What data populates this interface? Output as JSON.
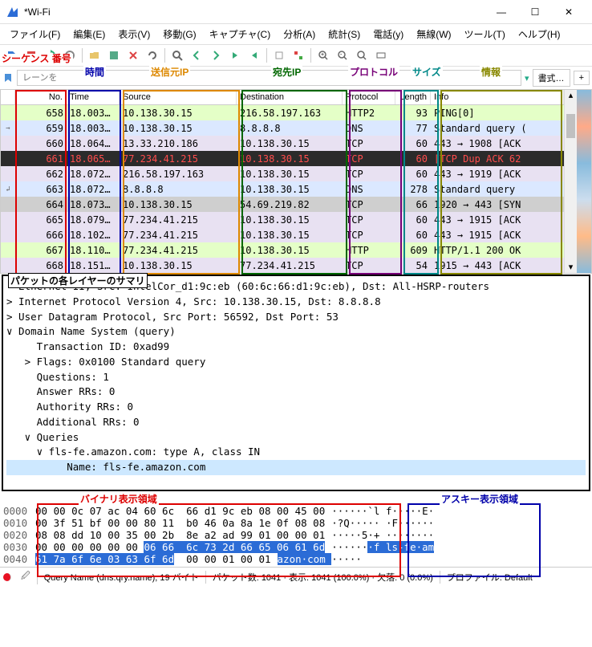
{
  "window": {
    "title": "*Wi-Fi"
  },
  "menu": {
    "file": "ファイル(F)",
    "edit": "編集(E)",
    "view": "表示(V)",
    "go": "移動(G)",
    "capture": "キャプチャ(C)",
    "analyze": "分析(A)",
    "stats": "統計(S)",
    "telephony": "電話(y)",
    "wireless": "無線(W)",
    "tools": "ツール(T)",
    "help": "ヘルプ(H)"
  },
  "filter": {
    "placeholder": "レーンを",
    "expr_btn": "書式…",
    "plus": "+"
  },
  "annotations": {
    "seq": "シーケンス\n番号",
    "time": "時間",
    "src": "送信元IP",
    "dst": "宛先IP",
    "proto": "プロトコル",
    "size": "サイズ",
    "info": "情報",
    "layers": "パケットの各レイヤーのサマリ",
    "binary": "バイナリ表示領域",
    "ascii": "アスキー表示領域"
  },
  "cols": {
    "no": "No.",
    "time": "Time",
    "src": "Source",
    "dst": "Destination",
    "proto": "Protocol",
    "len": "Length",
    "info": "Info"
  },
  "packets": [
    {
      "no": 658,
      "time": "18.003…",
      "src": "10.138.30.15",
      "dst": "216.58.197.163",
      "proto": "HTTP2",
      "len": 93,
      "info": "PING[0]",
      "bg": "#e4ffc7"
    },
    {
      "no": 659,
      "time": "18.003…",
      "src": "10.138.30.15",
      "dst": "8.8.8.8",
      "proto": "DNS",
      "len": 77,
      "info": "Standard query (",
      "bg": "#dbe8ff",
      "g": "→"
    },
    {
      "no": 660,
      "time": "18.064…",
      "src": "13.33.210.186",
      "dst": "10.138.30.15",
      "proto": "TCP",
      "len": 60,
      "info": "443 → 1908 [ACK",
      "bg": "#e8e1f2"
    },
    {
      "no": 661,
      "time": "18.065…",
      "src": "77.234.41.215",
      "dst": "10.138.30.15",
      "proto": "TCP",
      "len": 60,
      "info": "[TCP Dup ACK 62",
      "bg": "#2b2b2b",
      "fg": "#ff4d4d",
      "sel": true
    },
    {
      "no": 662,
      "time": "18.072…",
      "src": "216.58.197.163",
      "dst": "10.138.30.15",
      "proto": "TCP",
      "len": 60,
      "info": "443 → 1919 [ACK",
      "bg": "#e8e1f2"
    },
    {
      "no": 663,
      "time": "18.072…",
      "src": "8.8.8.8",
      "dst": "10.138.30.15",
      "proto": "DNS",
      "len": 278,
      "info": "Standard query",
      "bg": "#dbe8ff",
      "g": "↲"
    },
    {
      "no": 664,
      "time": "18.073…",
      "src": "10.138.30.15",
      "dst": "54.69.219.82",
      "proto": "TCP",
      "len": 66,
      "info": "1920 → 443 [SYN",
      "bg": "#cfcfcf"
    },
    {
      "no": 665,
      "time": "18.079…",
      "src": "77.234.41.215",
      "dst": "10.138.30.15",
      "proto": "TCP",
      "len": 60,
      "info": "443 → 1915 [ACK",
      "bg": "#e8e1f2"
    },
    {
      "no": 666,
      "time": "18.102…",
      "src": "77.234.41.215",
      "dst": "10.138.30.15",
      "proto": "TCP",
      "len": 60,
      "info": "443 → 1915 [ACK",
      "bg": "#e8e1f2"
    },
    {
      "no": 667,
      "time": "18.110…",
      "src": "77.234.41.215",
      "dst": "10.138.30.15",
      "proto": "HTTP",
      "len": 609,
      "info": "HTTP/1.1 200 OK",
      "bg": "#e4ffc7"
    },
    {
      "no": 668,
      "time": "18.151…",
      "src": "10.138.30.15",
      "dst": "77.234.41.215",
      "proto": "TCP",
      "len": 54,
      "info": "1915 → 443 [ACK",
      "bg": "#e8e1f2"
    }
  ],
  "detail": {
    "l0": "  Ethernet II, Src: IntelCor_d1:9c:eb (60:6c:66:d1:9c:eb), Dst: All-HSRP-routers",
    "l1": "> Internet Protocol Version 4, Src: 10.138.30.15, Dst: 8.8.8.8",
    "l2": "> User Datagram Protocol, Src Port: 56592, Dst Port: 53",
    "l3": "∨ Domain Name System (query)",
    "l4": "     Transaction ID: 0xad99",
    "l5": "   > Flags: 0x0100 Standard query",
    "l6": "     Questions: 1",
    "l7": "     Answer RRs: 0",
    "l8": "     Authority RRs: 0",
    "l9": "     Additional RRs: 0",
    "l10": "   ∨ Queries",
    "l11": "     ∨ fls-fe.amazon.com: type A, class IN",
    "l12": "          Name: fls-fe.amazon.com"
  },
  "hex": [
    {
      "off": "0000",
      "b": "00 00 0c 07 ac 04 60 6c  66 d1 9c eb 08 00 45 00",
      "a": "······`l f·····E·"
    },
    {
      "off": "0010",
      "b": "00 3f 51 bf 00 00 80 11  b0 46 0a 8a 1e 0f 08 08",
      "a": "·?Q····· ·F······"
    },
    {
      "off": "0020",
      "b": "08 08 dd 10 00 35 00 2b  8e a2 ad 99 01 00 00 01",
      "a": "·····5·+ ········"
    },
    {
      "off": "0030",
      "b1": "00 00 00 00 00 00 ",
      "bh": "06 66  6c 73 2d 66 65 06 61 6d",
      "a1": "······",
      "ah": "·f ls-fe·am"
    },
    {
      "off": "0040",
      "bh": "61 7a 6f 6e 03 63 6f 6d",
      "bm": "  00",
      "b2": " 00 01 00 01",
      "ah": "azon·com ",
      "a2": "·····"
    }
  ],
  "status": {
    "field": "Query Name (dns.qry.name), 19 バイト",
    "packets": "パケット数: 1041 · 表示: 1041 (100.0%) · 欠落: 0 (0.0%)",
    "profile": "プロファイル: Default"
  }
}
